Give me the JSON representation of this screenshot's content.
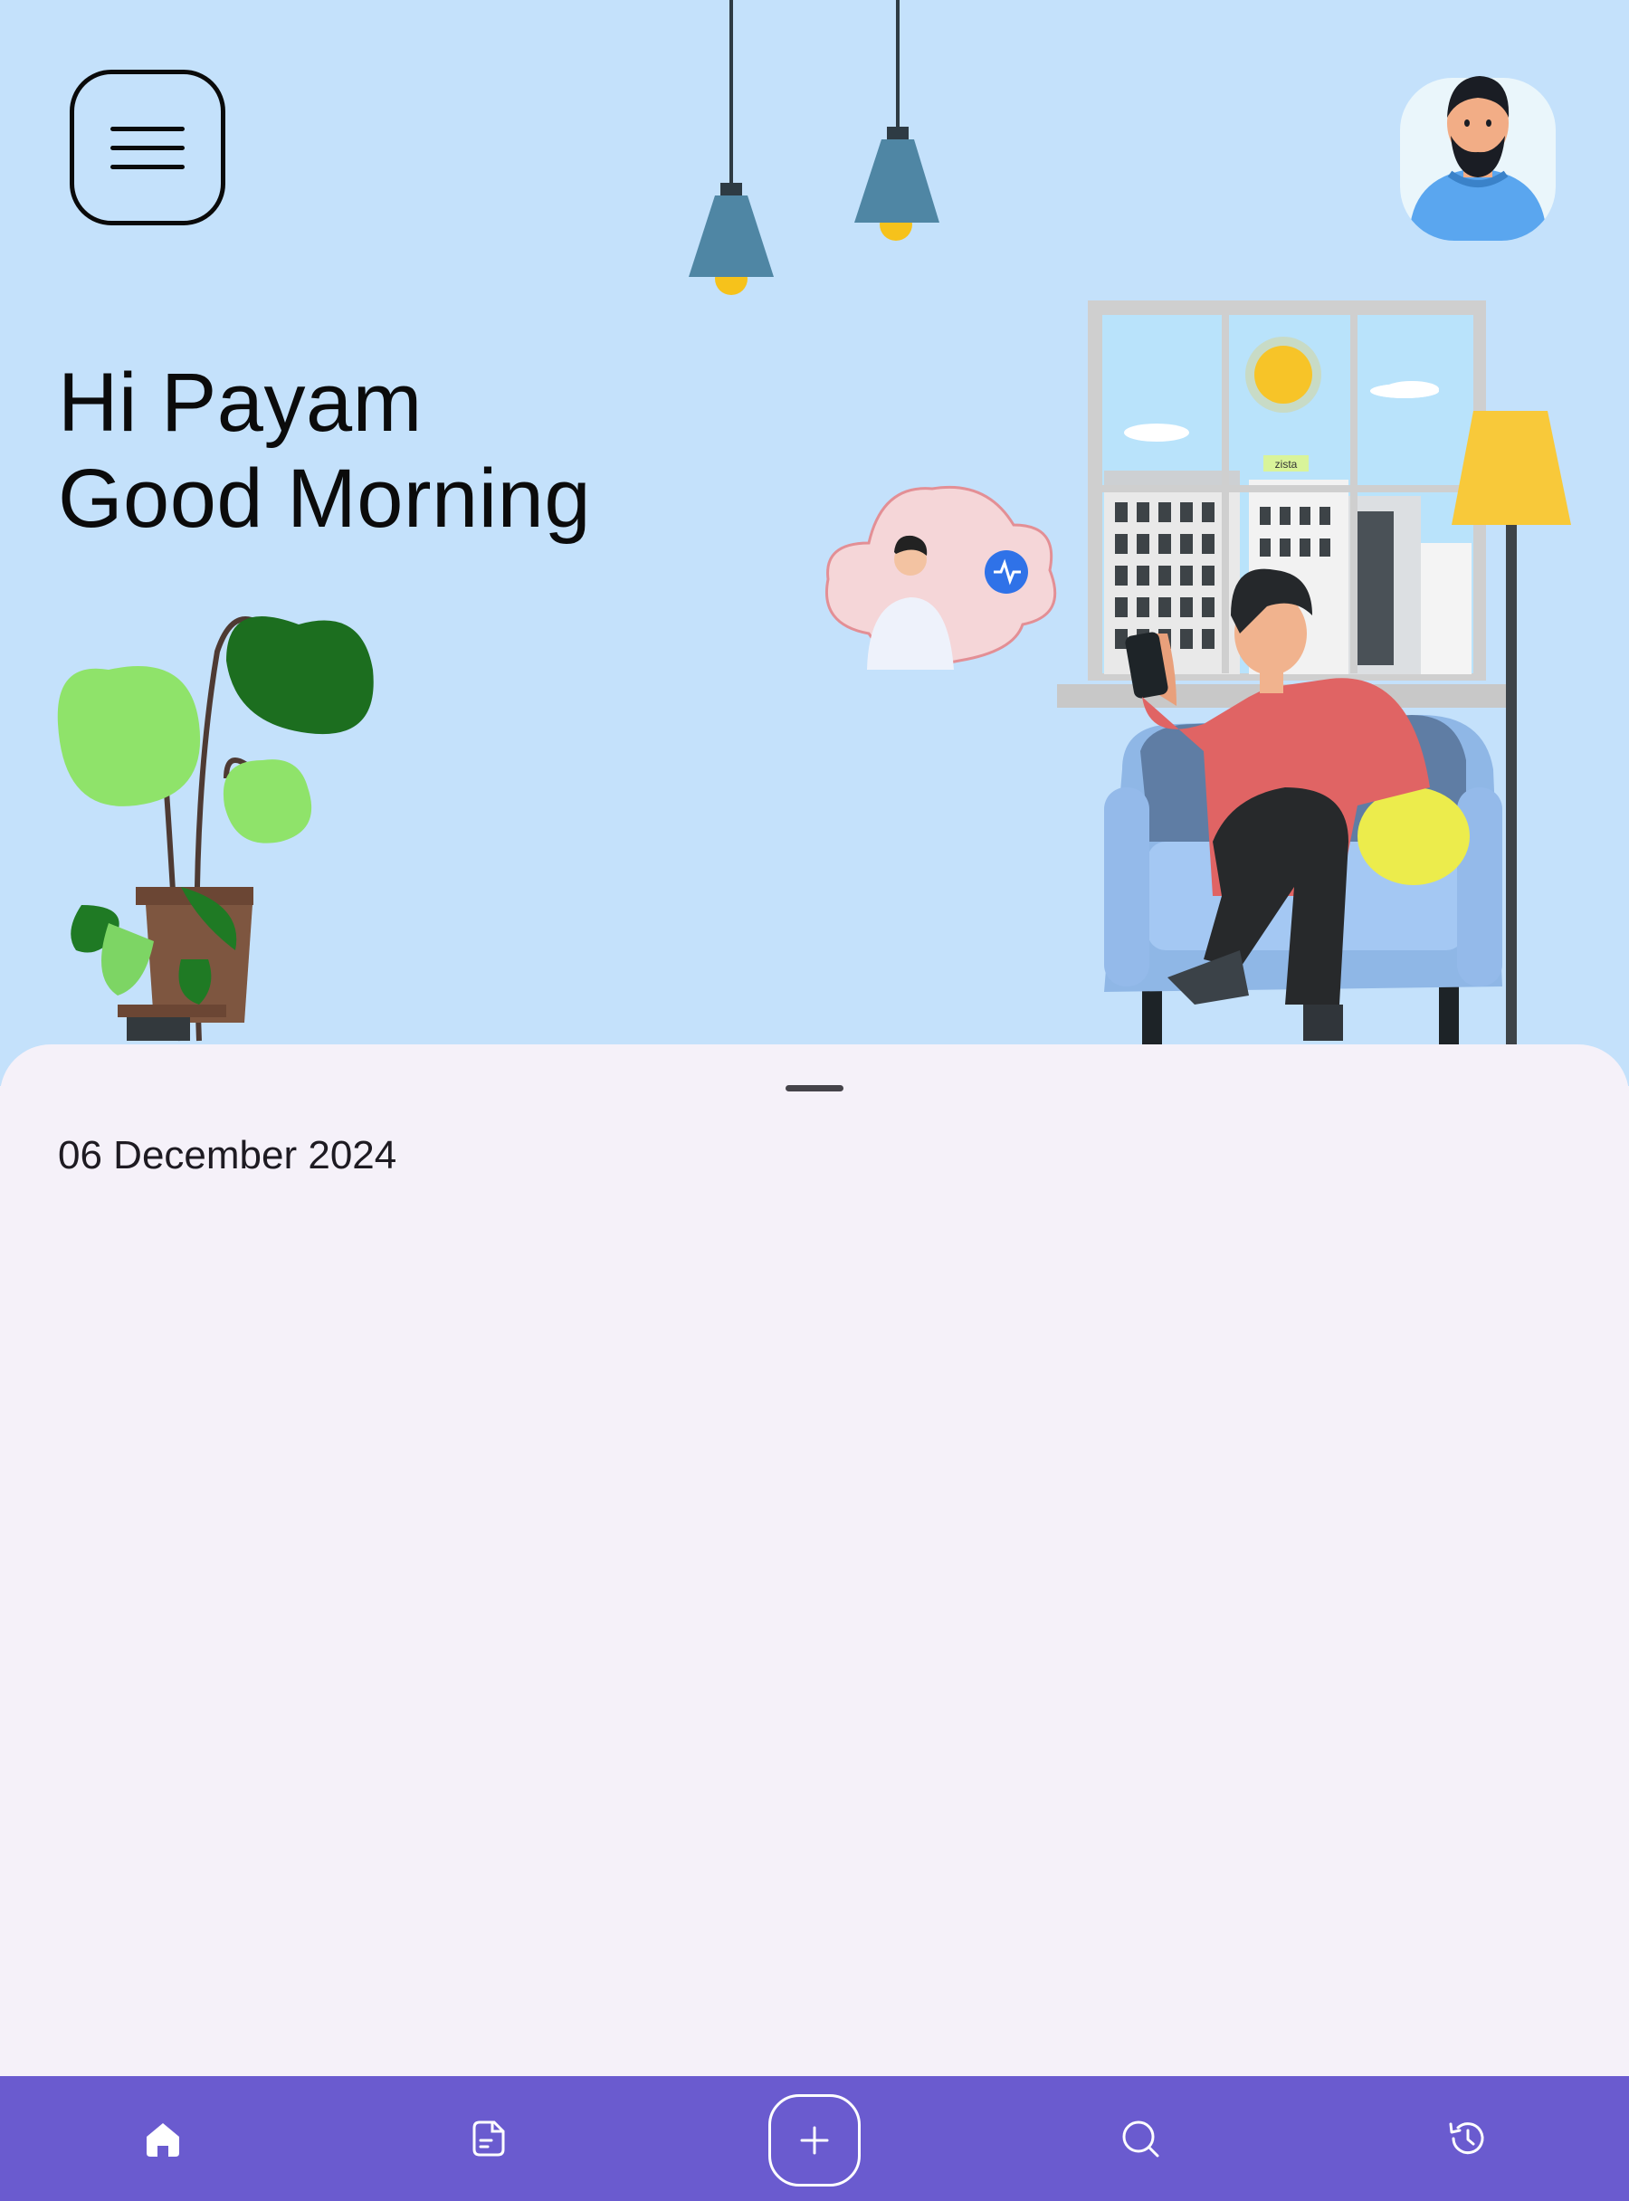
{
  "header": {
    "menu_icon": "hamburger-menu-icon",
    "avatar_icon": "user-avatar-icon"
  },
  "greeting": {
    "line1": "Hi Payam",
    "line2": "Good Morning"
  },
  "illustration": {
    "building_sign": "zista"
  },
  "sheet": {
    "date": "06 December 2024"
  },
  "bottom_nav": {
    "items": [
      {
        "icon": "home-icon",
        "active": true
      },
      {
        "icon": "notes-icon",
        "active": false
      },
      {
        "icon": "add-icon",
        "active": false
      },
      {
        "icon": "search-icon",
        "active": false
      },
      {
        "icon": "history-icon",
        "active": false
      }
    ]
  },
  "colors": {
    "hero_bg": "#c4e1fb",
    "sheet_bg": "#f5f1f9",
    "nav_bg": "#6a5bcf"
  }
}
